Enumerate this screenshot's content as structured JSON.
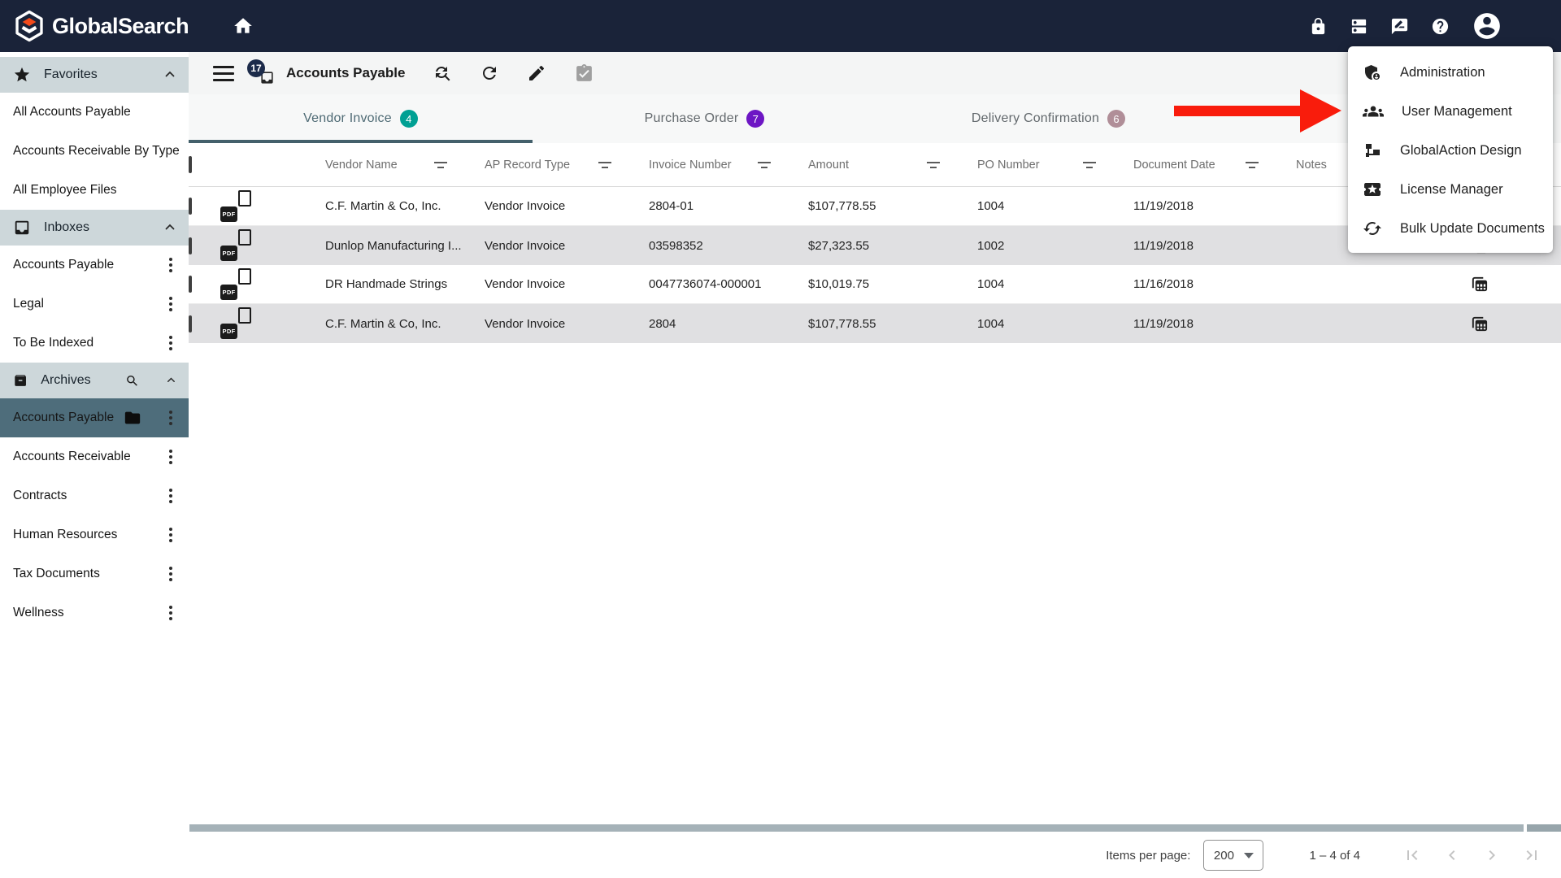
{
  "colors": {
    "header_navy": "#1a2339",
    "logo_orange": "#f44a1a",
    "sidebar_section_bg": "#cdd7da",
    "selected_item_bg": "#4e6d7b",
    "tab_indicator": "#44606b",
    "badge_teal": "#00a093",
    "badge_purple": "#6d16c4",
    "badge_rose": "#b08e98",
    "row_alt_gray": "#e0e0e2",
    "arrow_red": "#f91c0c",
    "scrollbar_thumb": "#a5b2b8"
  },
  "header": {
    "brand": "GlobalSearch"
  },
  "sidebar": {
    "favorites": {
      "title": "Favorites",
      "items": [
        {
          "label": "All Accounts Payable"
        },
        {
          "label": "Accounts Receivable By Type"
        },
        {
          "label": "All Employee Files"
        }
      ]
    },
    "inboxes": {
      "title": "Inboxes",
      "items": [
        {
          "label": "Accounts Payable"
        },
        {
          "label": "Legal"
        },
        {
          "label": "To Be Indexed"
        }
      ]
    },
    "archives": {
      "title": "Archives",
      "selected": {
        "label": "Accounts Payable"
      },
      "items": [
        {
          "label": "Accounts Receivable"
        },
        {
          "label": "Contracts"
        },
        {
          "label": "Human Resources"
        },
        {
          "label": "Tax Documents"
        },
        {
          "label": "Wellness"
        }
      ]
    }
  },
  "toolbar": {
    "badge_count": "17",
    "title": "Accounts Payable"
  },
  "tabs": [
    {
      "label": "Vendor Invoice",
      "count": "4"
    },
    {
      "label": "Purchase Order",
      "count": "7"
    },
    {
      "label": "Delivery Confirmation",
      "count": "6"
    }
  ],
  "table": {
    "columns": [
      "Vendor Name",
      "AP Record Type",
      "Invoice Number",
      "Amount",
      "PO Number",
      "Document Date",
      "Notes"
    ],
    "rows": [
      {
        "vendor": "C.F. Martin & Co, Inc.",
        "type": "Vendor Invoice",
        "invoice": "2804-01",
        "amount": "$107,778.55",
        "po": "1004",
        "date": "11/19/2018"
      },
      {
        "vendor": "Dunlop Manufacturing I...",
        "type": "Vendor Invoice",
        "invoice": "03598352",
        "amount": "$27,323.55",
        "po": "1002",
        "date": "11/19/2018"
      },
      {
        "vendor": "DR Handmade Strings",
        "type": "Vendor Invoice",
        "invoice": "0047736074-000001",
        "amount": "$10,019.75",
        "po": "1004",
        "date": "11/16/2018"
      },
      {
        "vendor": "C.F. Martin & Co, Inc.",
        "type": "Vendor Invoice",
        "invoice": "2804",
        "amount": "$107,778.55",
        "po": "1004",
        "date": "11/19/2018"
      }
    ]
  },
  "menu": {
    "items": [
      {
        "label": "Administration"
      },
      {
        "label": "User Management"
      },
      {
        "label": "GlobalAction Design"
      },
      {
        "label": "License Manager"
      },
      {
        "label": "Bulk Update Documents"
      }
    ]
  },
  "footer": {
    "items_per_page_label": "Items per page:",
    "items_per_page_value": "200",
    "range_label": "1 – 4 of 4"
  }
}
